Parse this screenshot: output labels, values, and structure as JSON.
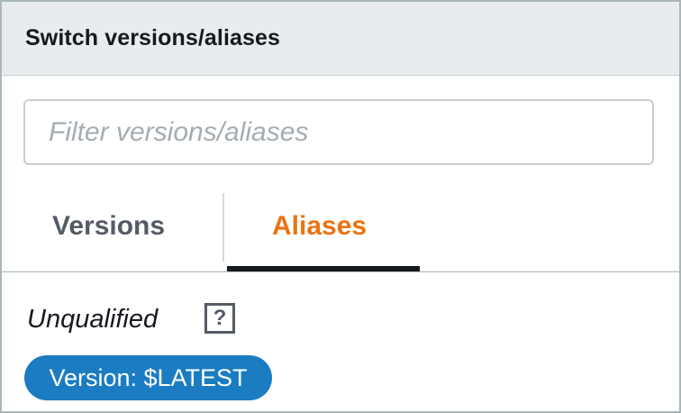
{
  "header": {
    "title": "Switch versions/aliases"
  },
  "filter": {
    "placeholder": "Filter versions/aliases",
    "value": ""
  },
  "tabs": [
    {
      "label": "Versions",
      "active": false
    },
    {
      "label": "Aliases",
      "active": true
    }
  ],
  "content": {
    "section_label": "Unqualified",
    "help_icon": "?",
    "version_badge": "Version: $LATEST"
  },
  "colors": {
    "header_bg": "#e9ecee",
    "active_tab": "#ec7211",
    "inactive_tab": "#545b64",
    "badge_bg": "#1b7cc1"
  }
}
